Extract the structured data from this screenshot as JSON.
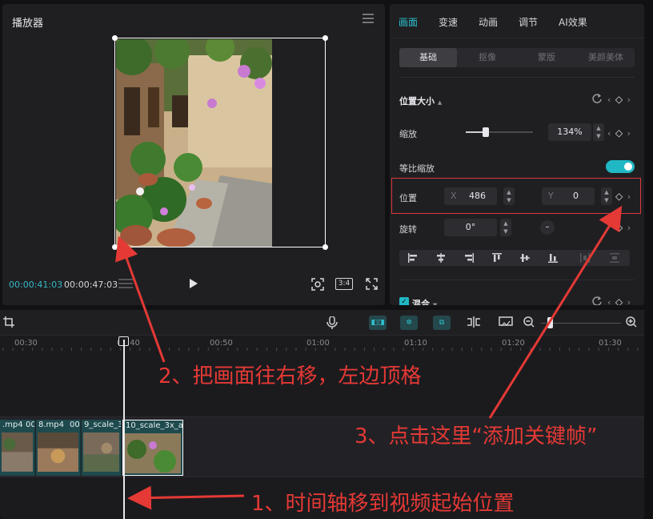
{
  "player": {
    "title": "播放器",
    "time_current": "00:00:41:03",
    "time_total": "00:00:47:03",
    "ratio_label": "3:4",
    "icons": [
      "menu-icon",
      "play-icon",
      "fit-icon",
      "fullscreen-icon"
    ]
  },
  "props": {
    "tabs": [
      "画面",
      "变速",
      "动画",
      "调节",
      "AI效果"
    ],
    "active_tab": "画面",
    "subtabs": [
      "基础",
      "抠像",
      "蒙版",
      "美颜美体"
    ],
    "active_subtab": "基础",
    "section_pos_size": "位置大小",
    "scale_label": "缩放",
    "scale_value": "134%",
    "scale_fraction": 0.3,
    "uniform_scale_label": "等比缩放",
    "uniform_scale_on": true,
    "position_label": "位置",
    "x_label": "X",
    "x_value": "486",
    "y_label": "Y",
    "y_value": "0",
    "rotate_label": "旋转",
    "rotate_value": "0°",
    "blend_label": "混合",
    "accent_color": "#20b8c4"
  },
  "timeline": {
    "ruler_labels": [
      "00:30",
      "00:40",
      "00:50",
      "01:00",
      "01:10",
      "01:20",
      "01:30"
    ],
    "clips": [
      {
        "name": ".mp4"
      },
      {
        "name": "8.mp4"
      },
      {
        "name": "9_scale_3"
      },
      {
        "name": "10_scale_3x_a"
      }
    ],
    "clip_extra": [
      "00",
      "00"
    ],
    "zoom_fraction": 0.1
  },
  "annotations": {
    "step2": "2、把画面往右移，左边顶格",
    "step3": "3、点击这里“添加关键帧”",
    "step1": "1、时间轴移到视频起始位置",
    "color": "#e53935"
  }
}
